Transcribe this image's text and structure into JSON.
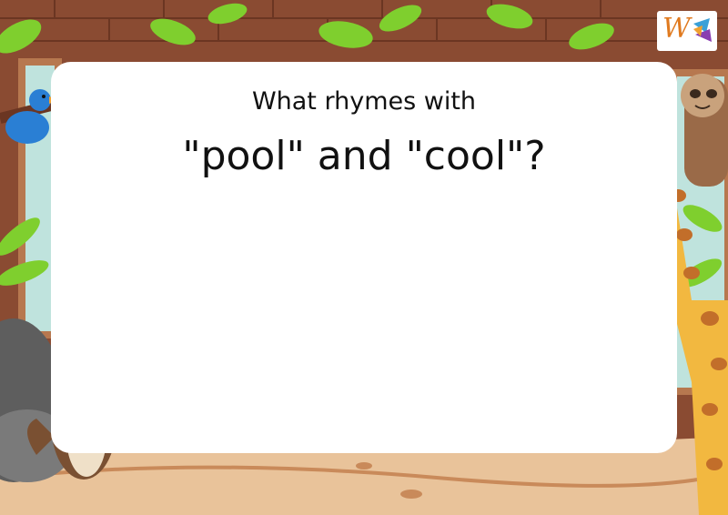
{
  "question": {
    "line1": "What rhymes with",
    "line2": "\"pool\" and \"cool\"?"
  },
  "logo": {
    "text": "W",
    "icon": "worksheet-logo-icon"
  },
  "colors": {
    "brick": "#8a4b32",
    "sand": "#e9c39a",
    "leaf": "#7fcf2e",
    "card": "#ffffff",
    "text": "#111111",
    "accent": "#e07a1f"
  },
  "decorations": [
    "bird-icon",
    "music-note-icon",
    "sloth-icon",
    "giraffe-icon",
    "otter-icon",
    "rock-icon",
    "leaf-icon"
  ]
}
